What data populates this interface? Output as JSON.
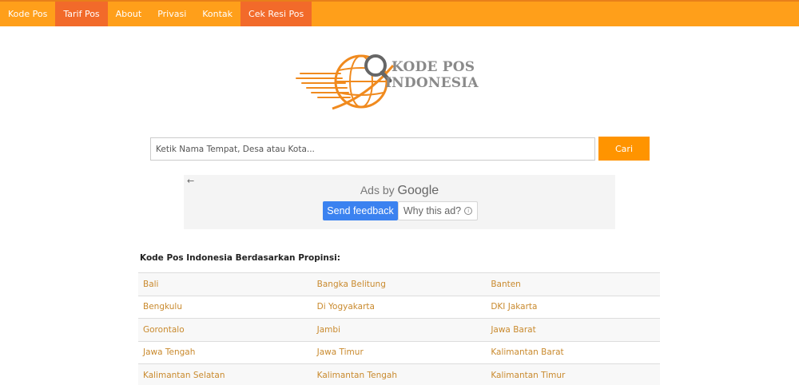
{
  "navbar": {
    "items": [
      {
        "label": "Kode Pos",
        "active": false
      },
      {
        "label": "Tarif Pos",
        "active": true
      },
      {
        "label": "About",
        "active": false
      },
      {
        "label": "Privasi",
        "active": false
      },
      {
        "label": "Kontak",
        "active": false
      },
      {
        "label": "Cek Resi Pos",
        "active": true
      }
    ]
  },
  "logo": {
    "line1": "KODE POS",
    "line2": "INDONESIA",
    "icon": "globe-magnifier-logo",
    "colors": {
      "orange": "#f08a1e",
      "gray": "#8a8a8a"
    }
  },
  "search": {
    "placeholder": "Ketik Nama Tempat, Desa atau Kota...",
    "value": "",
    "button_label": "Cari"
  },
  "ad": {
    "back_icon": "back-arrow-icon",
    "ads_by": "Ads by",
    "google": "Google",
    "feedback_label": "Send feedback",
    "why_label": "Why this ad?"
  },
  "section": {
    "title": "Kode Pos Indonesia Berdasarkan Propinsi:"
  },
  "provinces": [
    [
      "Bali",
      "Bangka Belitung",
      "Banten"
    ],
    [
      "Bengkulu",
      "Di Yogyakarta",
      "DKI Jakarta"
    ],
    [
      "Gorontalo",
      "Jambi",
      "Jawa Barat"
    ],
    [
      "Jawa Tengah",
      "Jawa Timur",
      "Kalimantan Barat"
    ],
    [
      "Kalimantan Selatan",
      "Kalimantan Tengah",
      "Kalimantan Timur"
    ]
  ],
  "colors": {
    "nav_bg": "#ff9f1a",
    "nav_active": "#f26a2a",
    "button": "#ff9400",
    "link": "#c98a2e",
    "ad_feedback": "#3b82f0"
  }
}
